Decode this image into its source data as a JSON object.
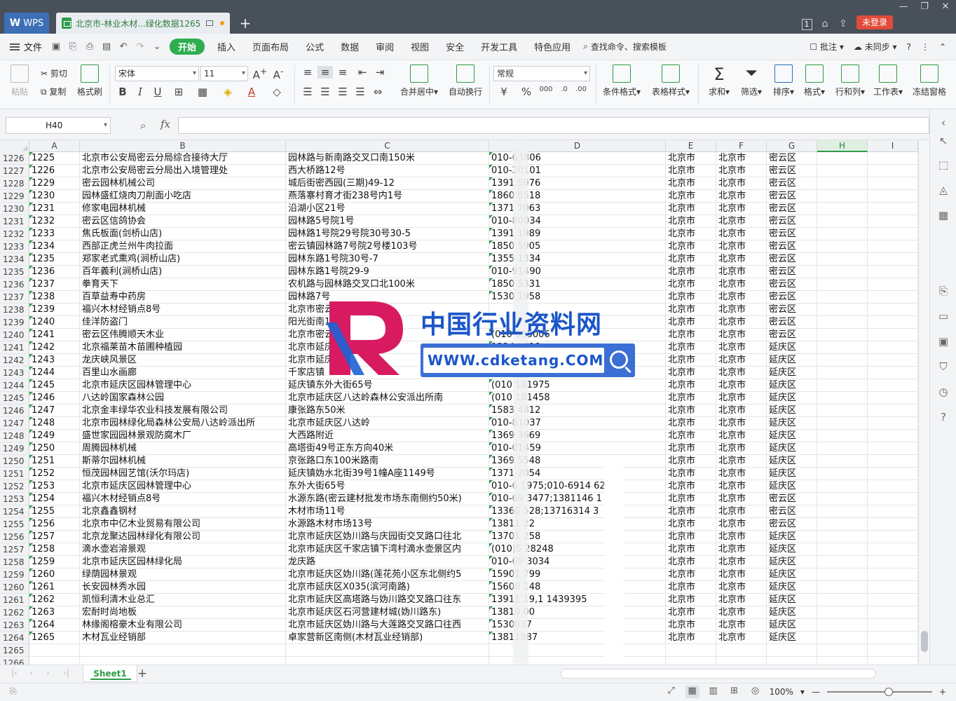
{
  "titlebar": {
    "app_label": "WPS",
    "doc_tab_title": "北京市-林业木材...绿化数据1265",
    "add_tab": "+",
    "login_label": "未登录"
  },
  "menu": {
    "file": "文件",
    "items": [
      "开始",
      "插入",
      "页面布局",
      "公式",
      "数据",
      "审阅",
      "视图",
      "安全",
      "开发工具",
      "特色应用"
    ],
    "search": "查找命令、搜索模板",
    "right": [
      "批注",
      "未同步"
    ]
  },
  "ribbon": {
    "paste": "粘贴",
    "cut": "剪切",
    "copy": "复制",
    "format_painter": "格式刷",
    "font_name": "宋体",
    "font_size": "11",
    "merge_center": "合并居中",
    "wrap_text": "自动换行",
    "number_format": "常规",
    "conditional_format": "条件格式",
    "table_style": "表格样式",
    "sum": "求和",
    "filter": "筛选",
    "sort": "排序",
    "format": "格式",
    "row_col": "行和列",
    "worksheet": "工作表",
    "freeze": "冻结窗格"
  },
  "formula": {
    "cell_ref": "H40",
    "fx": "fx"
  },
  "columns": [
    "A",
    "B",
    "C",
    "D",
    "E",
    "F",
    "G",
    "H",
    "I"
  ],
  "rows": [
    {
      "r": "1226",
      "a": "1225",
      "b": "北京市公安局密云分局综合接待大厅",
      "c": "园林路与新南路交叉口南150米",
      "d": "010-63806",
      "e": "北京市",
      "f": "北京市",
      "g": "密云区"
    },
    {
      "r": "1227",
      "a": "1226",
      "b": "北京市公安局密云分局出入境管理处",
      "c": "西大桥路12号",
      "d": "010-20101",
      "e": "北京市",
      "f": "北京市",
      "g": "密云区"
    },
    {
      "r": "1228",
      "a": "1229",
      "b": "密云园林机械公司",
      "c": "城后街密西园(三期)49-12",
      "d": "1391 5976",
      "e": "北京市",
      "f": "北京市",
      "g": "密云区"
    },
    {
      "r": "1229",
      "a": "1230",
      "b": "园林盛红烧肉刀削面小吃店",
      "c": "燕落寨村育才街238号内1号",
      "d": "1860 8518",
      "e": "北京市",
      "f": "北京市",
      "g": "密云区"
    },
    {
      "r": "1230",
      "a": "1231",
      "b": "修家电园林机械",
      "c": "沿湖小区21号",
      "d": "1371 7063",
      "e": "北京市",
      "f": "北京市",
      "g": "密云区"
    },
    {
      "r": "1231",
      "a": "1232",
      "b": "密云区信鸽协会",
      "c": "园林路5号院1号",
      "d": "010-80034",
      "e": "北京市",
      "f": "北京市",
      "g": "密云区"
    },
    {
      "r": "1232",
      "a": "1233",
      "b": "焦氏板面(剑桥山店)",
      "c": "园林路1号院29号院30号30-5",
      "d": "1391 1989",
      "e": "北京市",
      "f": "北京市",
      "g": "密云区"
    },
    {
      "r": "1233",
      "a": "1234",
      "b": "西部正虎兰州牛肉拉面",
      "c": "密云镇园林路7号院2号楼103号",
      "d": "1850 5905",
      "e": "北京市",
      "f": "北京市",
      "g": "密云区"
    },
    {
      "r": "1234",
      "a": "1235",
      "b": "郑家老式熏鸡(涧桥山店)",
      "c": "园林东路1号院30号-7",
      "d": "1355 1334",
      "e": "北京市",
      "f": "北京市",
      "g": "密云区"
    },
    {
      "r": "1235",
      "a": "1236",
      "b": "百年義利(涧桥山店)",
      "c": "园林东路1号院29-9",
      "d": "010-91490",
      "e": "北京市",
      "f": "北京市",
      "g": "密云区"
    },
    {
      "r": "1236",
      "a": "1237",
      "b": "拳育天下",
      "c": "农机路与园林路交叉口北100米",
      "d": "1850 5331",
      "e": "北京市",
      "f": "北京市",
      "g": "密云区"
    },
    {
      "r": "1237",
      "a": "1238",
      "b": "百草益寿中药房",
      "c": "园林路7号",
      "d": "1530 1958",
      "e": "北京市",
      "f": "北京市",
      "g": "密云区"
    },
    {
      "r": "1238",
      "a": "1239",
      "b": "福兴木材经销点8号",
      "c": "北京市密云",
      "d": "",
      "e": "北京市",
      "f": "北京市",
      "g": "密云区"
    },
    {
      "r": "1239",
      "a": "1240",
      "b": "佳洋防盗门",
      "c": "阳光街南100米",
      "d": "",
      "e": "北京市",
      "f": "北京市",
      "g": "密云区"
    },
    {
      "r": "1240",
      "a": "1241",
      "b": "密云区伟腾顺天木业",
      "c": "北京市密云区密兴旧路与",
      "d": "(010 035006",
      "e": "北京市",
      "f": "北京市",
      "g": "密云区"
    },
    {
      "r": "1241",
      "a": "1242",
      "b": "北京福莱苗木苗圃种植园",
      "c": "北京市延庆",
      "d": "1324 1718",
      "e": "北京市",
      "f": "北京市",
      "g": "延庆区"
    },
    {
      "r": "1242",
      "a": "1243",
      "b": "龙庆峡风景区",
      "c": "北京市延庆区",
      "d": "",
      "e": "北京市",
      "f": "北京市",
      "g": "延庆区"
    },
    {
      "r": "1243",
      "a": "1244",
      "b": "百里山水画廊",
      "c": "千家店镇",
      "d": "(010 188559",
      "e": "北京市",
      "f": "北京市",
      "g": "延庆区"
    },
    {
      "r": "1244",
      "a": "1245",
      "b": "北京市延庆区园林管理中心",
      "c": "延庆镇东外大街65号",
      "d": "(010 181975",
      "e": "北京市",
      "f": "北京市",
      "g": "延庆区"
    },
    {
      "r": "1245",
      "a": "1246",
      "b": "八达岭国家森林公园",
      "c": "北京市延庆区八达岭森林公安派出所南",
      "d": "(010 181458",
      "e": "北京市",
      "f": "北京市",
      "g": "延庆区"
    },
    {
      "r": "1246",
      "a": "1247",
      "b": "北京金丰绿华农业科技发展有限公司",
      "c": "康张路东50米",
      "d": "1583 4812",
      "e": "北京市",
      "f": "北京市",
      "g": "延庆区"
    },
    {
      "r": "1247",
      "a": "1248",
      "b": "北京市园林绿化局森林公安局八达岭派出所",
      "c": "北京市延庆区八达岭",
      "d": "010-81037",
      "e": "北京市",
      "f": "北京市",
      "g": "延庆区"
    },
    {
      "r": "1248",
      "a": "1249",
      "b": "盛世家园园林景观防腐木厂",
      "c": "大西路附近",
      "d": "1369 3669",
      "e": "北京市",
      "f": "北京市",
      "g": "延庆区"
    },
    {
      "r": "1249",
      "a": "1250",
      "b": "周腾园林机械",
      "c": "高塔街49号正东方向40米",
      "d": "010-01459",
      "e": "北京市",
      "f": "北京市",
      "g": "延庆区"
    },
    {
      "r": "1250",
      "a": "1251",
      "b": "斯蒂尔园林机械",
      "c": "京张路口东100米路南",
      "d": "1369 5548",
      "e": "北京市",
      "f": "北京市",
      "g": "延庆区"
    },
    {
      "r": "1251",
      "a": "1252",
      "b": "恒茂园林园艺馆(沃尔玛店)",
      "c": "延庆镇妫水北街39号1幢A座1149号",
      "d": "1371 2054",
      "e": "北京市",
      "f": "北京市",
      "g": "延庆区"
    },
    {
      "r": "1252",
      "a": "1253",
      "b": "北京市延庆区园林管理中心",
      "c": "东外大街65号",
      "d": "010-6 1975;010-6914 62",
      "e": "北京市",
      "f": "北京市",
      "g": "延庆区"
    },
    {
      "r": "1253",
      "a": "1254",
      "b": "福兴木材经销点8号",
      "c": "水源东路(密云建材批发市场东南侧约50米)",
      "d": "010-69 3477;1381146 1",
      "e": "北京市",
      "f": "北京市",
      "g": "密云区"
    },
    {
      "r": "1254",
      "a": "1255",
      "b": "北京鑫鑫钢材",
      "c": "木材市场11号",
      "d": "13366 528;13716314 3",
      "e": "北京市",
      "f": "北京市",
      "g": "密云区"
    },
    {
      "r": "1255",
      "a": "1256",
      "b": "北京市中亿木业贸易有限公司",
      "c": "水源路木材市场13号",
      "d": "13811 22",
      "e": "北京市",
      "f": "北京市",
      "g": "密云区"
    },
    {
      "r": "1256",
      "a": "1257",
      "b": "北京龙聚达园林绿化有限公司",
      "c": "北京市延庆区妫川路与庆园街交叉路口往北",
      "d": "13701 258",
      "e": "北京市",
      "f": "北京市",
      "g": "延庆区"
    },
    {
      "r": "1257",
      "a": "1258",
      "b": "滴水壶岩溶景观",
      "c": "北京市延庆区千家店镇下湾村滴水壶景区内",
      "d": "(010)5 28248",
      "e": "北京市",
      "f": "北京市",
      "g": "延庆区"
    },
    {
      "r": "1258",
      "a": "1259",
      "b": "北京市延庆区园林绿化局",
      "c": "龙庆路",
      "d": "010-69 3034",
      "e": "北京市",
      "f": "北京市",
      "g": "延庆区"
    },
    {
      "r": "1259",
      "a": "1260",
      "b": "绿荫园林景观",
      "c": "北京市延庆区妫川路(莲花苑小区东北侧约5",
      "d": "15901 799",
      "e": "北京市",
      "f": "北京市",
      "g": "延庆区"
    },
    {
      "r": "1260",
      "a": "1261",
      "b": "长安园林秀水园",
      "c": "北京市延庆区X035(滨河南路)",
      "d": "15600 148",
      "e": "北京市",
      "f": "北京市",
      "g": "延庆区"
    },
    {
      "r": "1261",
      "a": "1262",
      "b": "凯恒利清木业总汇",
      "c": "北京市延庆区高塔路与妫川路交叉路口往东",
      "d": "13911 19,1 1439395",
      "e": "北京市",
      "f": "北京市",
      "g": "延庆区"
    },
    {
      "r": "1262",
      "a": "1263",
      "b": "宏耐时尚地板",
      "c": "北京市延庆区石河营建材城(妫川路东)",
      "d": "13810 00",
      "e": "北京市",
      "f": "北京市",
      "g": "延庆区"
    },
    {
      "r": "1263",
      "a": "1264",
      "b": "林缘阁榕豪木业有限公司",
      "c": "北京市延庆区妫川路与大莲路交叉路口往西",
      "d": "1530037",
      "e": "北京市",
      "f": "北京市",
      "g": "延庆区"
    },
    {
      "r": "1264",
      "a": "1265",
      "b": "木材瓦业经销部",
      "c": "卓家营新区南侧(木材瓦业经销部)",
      "d": "13811987",
      "e": "北京市",
      "f": "北京市",
      "g": "延庆区"
    },
    {
      "r": "1265",
      "a": "",
      "b": "",
      "c": "",
      "d": "",
      "e": "",
      "f": "",
      "g": ""
    },
    {
      "r": "1266",
      "a": "",
      "b": "",
      "c": "",
      "d": "",
      "e": "",
      "f": "",
      "g": ""
    }
  ],
  "watermark": {
    "title": "中国行业资料网",
    "url": "WWW.cdketang.COM"
  },
  "sheets": {
    "active": "Sheet1",
    "add": "+"
  },
  "status": {
    "zoom": "100%"
  }
}
